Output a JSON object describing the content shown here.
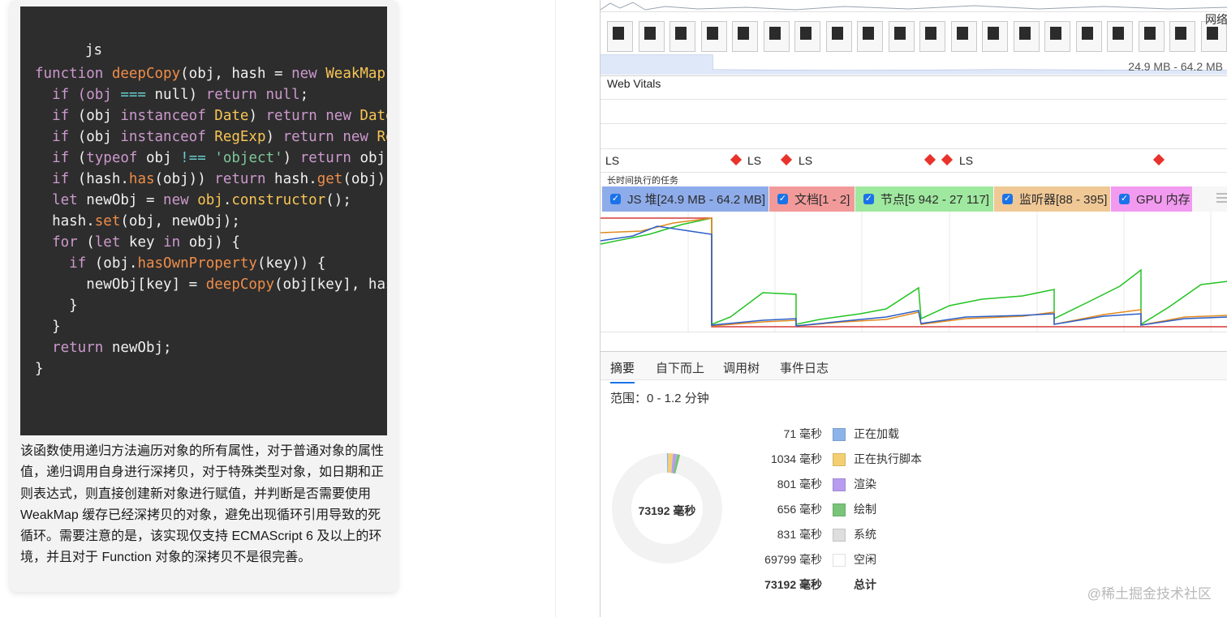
{
  "article": {
    "code_lang": "js",
    "code_lines": [
      [
        {
          "t": "function ",
          "c": "kw"
        },
        {
          "t": "deepCopy",
          "c": "fn"
        },
        {
          "t": "(obj, hash = ",
          "c": ""
        },
        {
          "t": "new ",
          "c": "kw"
        },
        {
          "t": "WeakMap",
          "c": "cls"
        },
        {
          "t": "(",
          "c": ""
        }
      ],
      [
        {
          "t": "  if (obj ",
          "c": "kw"
        },
        {
          "t": "===",
          "c": "op"
        },
        {
          "t": " null) ",
          "c": ""
        },
        {
          "t": "return null",
          "c": "kw"
        },
        {
          "t": ";",
          "c": ""
        }
      ],
      [
        {
          "t": "  if ",
          "c": "kw"
        },
        {
          "t": "(obj ",
          "c": ""
        },
        {
          "t": "instanceof ",
          "c": "kw"
        },
        {
          "t": "Date",
          "c": "cls"
        },
        {
          "t": ") ",
          "c": ""
        },
        {
          "t": "return new ",
          "c": "kw"
        },
        {
          "t": "Date",
          "c": "cls"
        }
      ],
      [
        {
          "t": "  if ",
          "c": "kw"
        },
        {
          "t": "(obj ",
          "c": ""
        },
        {
          "t": "instanceof ",
          "c": "kw"
        },
        {
          "t": "RegExp",
          "c": "cls"
        },
        {
          "t": ") ",
          "c": ""
        },
        {
          "t": "return new ",
          "c": "kw"
        },
        {
          "t": "Re",
          "c": "cls"
        }
      ],
      [
        {
          "t": "  if ",
          "c": "kw"
        },
        {
          "t": "(",
          "c": ""
        },
        {
          "t": "typeof ",
          "c": "kw"
        },
        {
          "t": "obj ",
          "c": ""
        },
        {
          "t": "!==",
          "c": "op"
        },
        {
          "t": " ",
          "c": ""
        },
        {
          "t": "'object'",
          "c": "str"
        },
        {
          "t": ") ",
          "c": ""
        },
        {
          "t": "return ",
          "c": "kw"
        },
        {
          "t": "obj;",
          "c": ""
        }
      ],
      [
        {
          "t": "  if ",
          "c": "kw"
        },
        {
          "t": "(hash.",
          "c": ""
        },
        {
          "t": "has",
          "c": "fn"
        },
        {
          "t": "(obj)) ",
          "c": ""
        },
        {
          "t": "return ",
          "c": "kw"
        },
        {
          "t": "hash.",
          "c": ""
        },
        {
          "t": "get",
          "c": "fn"
        },
        {
          "t": "(obj);",
          "c": ""
        }
      ],
      [
        {
          "t": "  let ",
          "c": "kw"
        },
        {
          "t": "newObj = ",
          "c": ""
        },
        {
          "t": "new ",
          "c": "kw"
        },
        {
          "t": "obj",
          "c": "cls"
        },
        {
          "t": ".",
          "c": ""
        },
        {
          "t": "constructor",
          "c": "cls"
        },
        {
          "t": "();",
          "c": ""
        }
      ],
      [
        {
          "t": "  hash.",
          "c": ""
        },
        {
          "t": "set",
          "c": "fn"
        },
        {
          "t": "(obj, newObj);",
          "c": ""
        }
      ],
      [
        {
          "t": "  for ",
          "c": "kw"
        },
        {
          "t": "(",
          "c": ""
        },
        {
          "t": "let ",
          "c": "kw"
        },
        {
          "t": "key ",
          "c": ""
        },
        {
          "t": "in ",
          "c": "kw"
        },
        {
          "t": "obj) {",
          "c": ""
        }
      ],
      [
        {
          "t": "    if ",
          "c": "kw"
        },
        {
          "t": "(obj.",
          "c": ""
        },
        {
          "t": "hasOwnProperty",
          "c": "fn"
        },
        {
          "t": "(key)) {",
          "c": ""
        }
      ],
      [
        {
          "t": "      newObj[key] = ",
          "c": ""
        },
        {
          "t": "deepCopy",
          "c": "fn"
        },
        {
          "t": "(obj[key], has",
          "c": ""
        }
      ],
      [
        {
          "t": "    }",
          "c": ""
        }
      ],
      [
        {
          "t": "  }",
          "c": ""
        }
      ],
      [
        {
          "t": "  return ",
          "c": "kw"
        },
        {
          "t": "newObj;",
          "c": ""
        }
      ],
      [
        {
          "t": "}",
          "c": ""
        }
      ]
    ],
    "description": "该函数使用递归方法遍历对象的所有属性，对于普通对象的属性值，递归调用自身进行深拷贝，对于特殊类型对象，如日期和正则表达式，则直接创建新对象进行赋值，并判断是否需要使用 WeakMap 缓存已经深拷贝的对象，避免出现循环引用导致的死循环。需要注意的是，该实现仅支持 ECMAScript 6 及以上的环境，并且对于 Function 对象的深拷贝不是很完善。"
  },
  "devtools": {
    "overview_net_label": "网络",
    "overview_mem_label": "24.9 MB - 64.2 MB",
    "web_vitals_title": "Web Vitals",
    "ls_label": "LS",
    "long_tasks_title": "长时间执行的任务",
    "legend": [
      {
        "label": "JS 堆[24.9 MB - 64.2 MB]",
        "color": "#7f9fe8"
      },
      {
        "label": "文档[1 - 2]",
        "color": "#f08a8a"
      },
      {
        "label": "节点[5 942 - 27 117]",
        "color": "#8ee38e"
      },
      {
        "label": "监听器[88 - 395]",
        "color": "#f0c28a"
      },
      {
        "label": "GPU 内存",
        "color": "#f08ae8"
      }
    ],
    "tabs": [
      "摘要",
      "自下而上",
      "调用树",
      "事件日志"
    ],
    "range": "范围：0 - 1.2 分钟",
    "donut_total": "73192 毫秒",
    "stats": [
      {
        "value": "71 毫秒",
        "name": "正在加载",
        "color": "#8cb4ea"
      },
      {
        "value": "1034 毫秒",
        "name": "正在执行脚本",
        "color": "#f3cf72"
      },
      {
        "value": "801 毫秒",
        "name": "渲染",
        "color": "#b89cf0"
      },
      {
        "value": "656 毫秒",
        "name": "绘制",
        "color": "#79c479"
      },
      {
        "value": "831 毫秒",
        "name": "系统",
        "color": "#dedede"
      },
      {
        "value": "69799 毫秒",
        "name": "空闲",
        "color": "#ffffff"
      }
    ],
    "total": {
      "value": "73192 毫秒",
      "name": "总计"
    },
    "watermark": "@稀土掘金技术社区"
  }
}
